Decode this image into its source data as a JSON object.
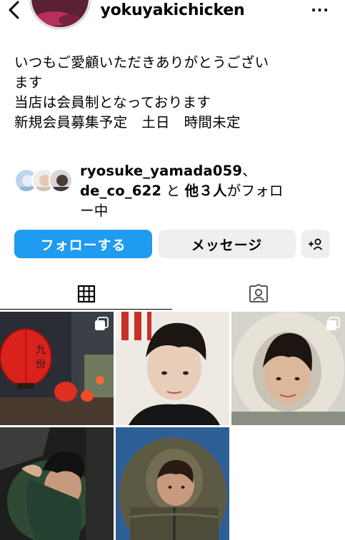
{
  "header": {
    "username": "yokuyakichicken",
    "back_icon": "chevron-left-icon",
    "more_icon": "ellipsis-icon",
    "more_label": "···"
  },
  "bio": {
    "lines": [
      "いつもご愛顧いただきありがとうござい",
      "ます",
      "当店は会員制となっております",
      "新規会員募集予定　土日　時間未定"
    ]
  },
  "followed_by": {
    "user1": "ryosuke_yamada059",
    "sep1": "、",
    "user2": "de_co_622",
    "mid": " と ",
    "others": "他３人",
    "tail1": "がフォロ",
    "tail2": "ー中"
  },
  "actions": {
    "follow_label": "フォローする",
    "message_label": "メッセージ",
    "add_user_icon": "add-person-icon",
    "follow_color": "#1f9bf0",
    "secondary_color": "#efefef"
  },
  "tabs": {
    "grid_icon": "grid-icon",
    "tagged_icon": "tagged-person-icon",
    "active": "grid"
  },
  "posts": [
    {
      "subject": "red paper lanterns in an alley",
      "multi": true
    },
    {
      "subject": "selfie of young man",
      "multi": false
    },
    {
      "subject": "young man in fur hood",
      "multi": true
    },
    {
      "subject": "young man in green hoodie in car",
      "multi": false
    },
    {
      "subject": "young man in olive puffer hood",
      "multi": false
    }
  ]
}
